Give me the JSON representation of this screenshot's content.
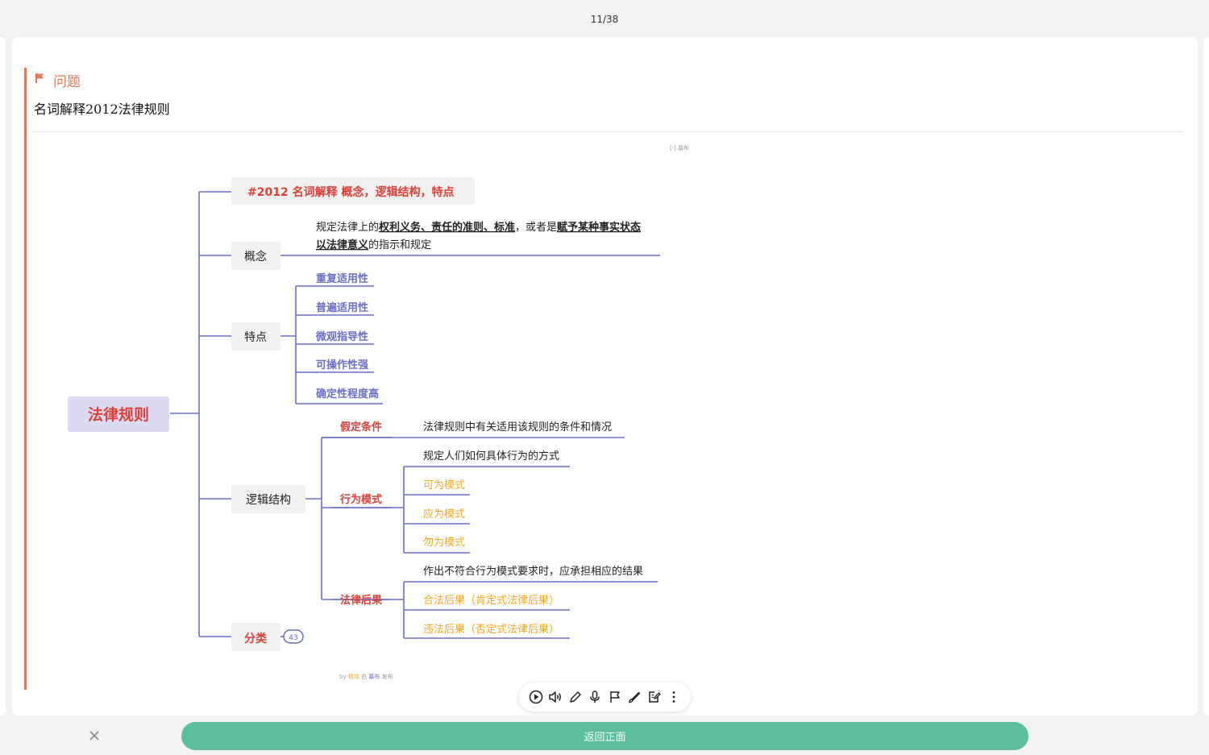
{
  "header": {
    "counter": "11/38"
  },
  "question": {
    "label": "问题",
    "text": "名词解释2012法律规则"
  },
  "mindmap": {
    "hint": "[·] 幕布",
    "credit": {
      "by": "by",
      "brand1": "精简",
      "mid": "由",
      "brand2": "幕布",
      "tail": "发布"
    },
    "root": "法律规则",
    "title_node": "#2012 名词解释 概念，逻辑结构，特点",
    "concept": {
      "label": "概念",
      "def_line1_a": "规定法律上的",
      "def_line1_b": "权利义务、责任的准则、标准",
      "def_line1_c": "，或者是",
      "def_line1_d": "赋予某种事实状态",
      "def_line2_a": "以法律意义",
      "def_line2_b": "的指示和规定"
    },
    "features": {
      "label": "特点",
      "items": [
        "重复适用性",
        "普遍适用性",
        "微观指导性",
        "可操作性强",
        "确定性程度高"
      ]
    },
    "logic": {
      "label": "逻辑结构",
      "assumption": {
        "label": "假定条件",
        "desc": "法律规则中有关适用该规则的条件和情况"
      },
      "behavior": {
        "label": "行为模式",
        "desc": "规定人们如何具体行为的方式",
        "items": [
          "可为模式",
          "应为模式",
          "勿为模式"
        ]
      },
      "consequence": {
        "label": "法律后果",
        "desc": "作出不符合行为模式要求时，应承担相应的结果",
        "items": [
          "合法后果（肯定式法律后果）",
          "违法后果（否定式法律后果）"
        ]
      }
    },
    "classification": {
      "label": "分类",
      "count": "43"
    }
  },
  "toolbar": {
    "icons": [
      "play-icon",
      "speaker-icon",
      "pencil-icon",
      "microphone-icon",
      "flag-icon",
      "brush-icon",
      "note-edit-icon",
      "more-icon"
    ]
  },
  "footer": {
    "back_label": "返回正面"
  },
  "colors": {
    "accent": "#e07a5f",
    "line": "#6a6ec7",
    "root_bg": "#dcdaf2",
    "root_text": "#d9413a",
    "orange": "#f5a623",
    "button": "#5dbd9f"
  }
}
